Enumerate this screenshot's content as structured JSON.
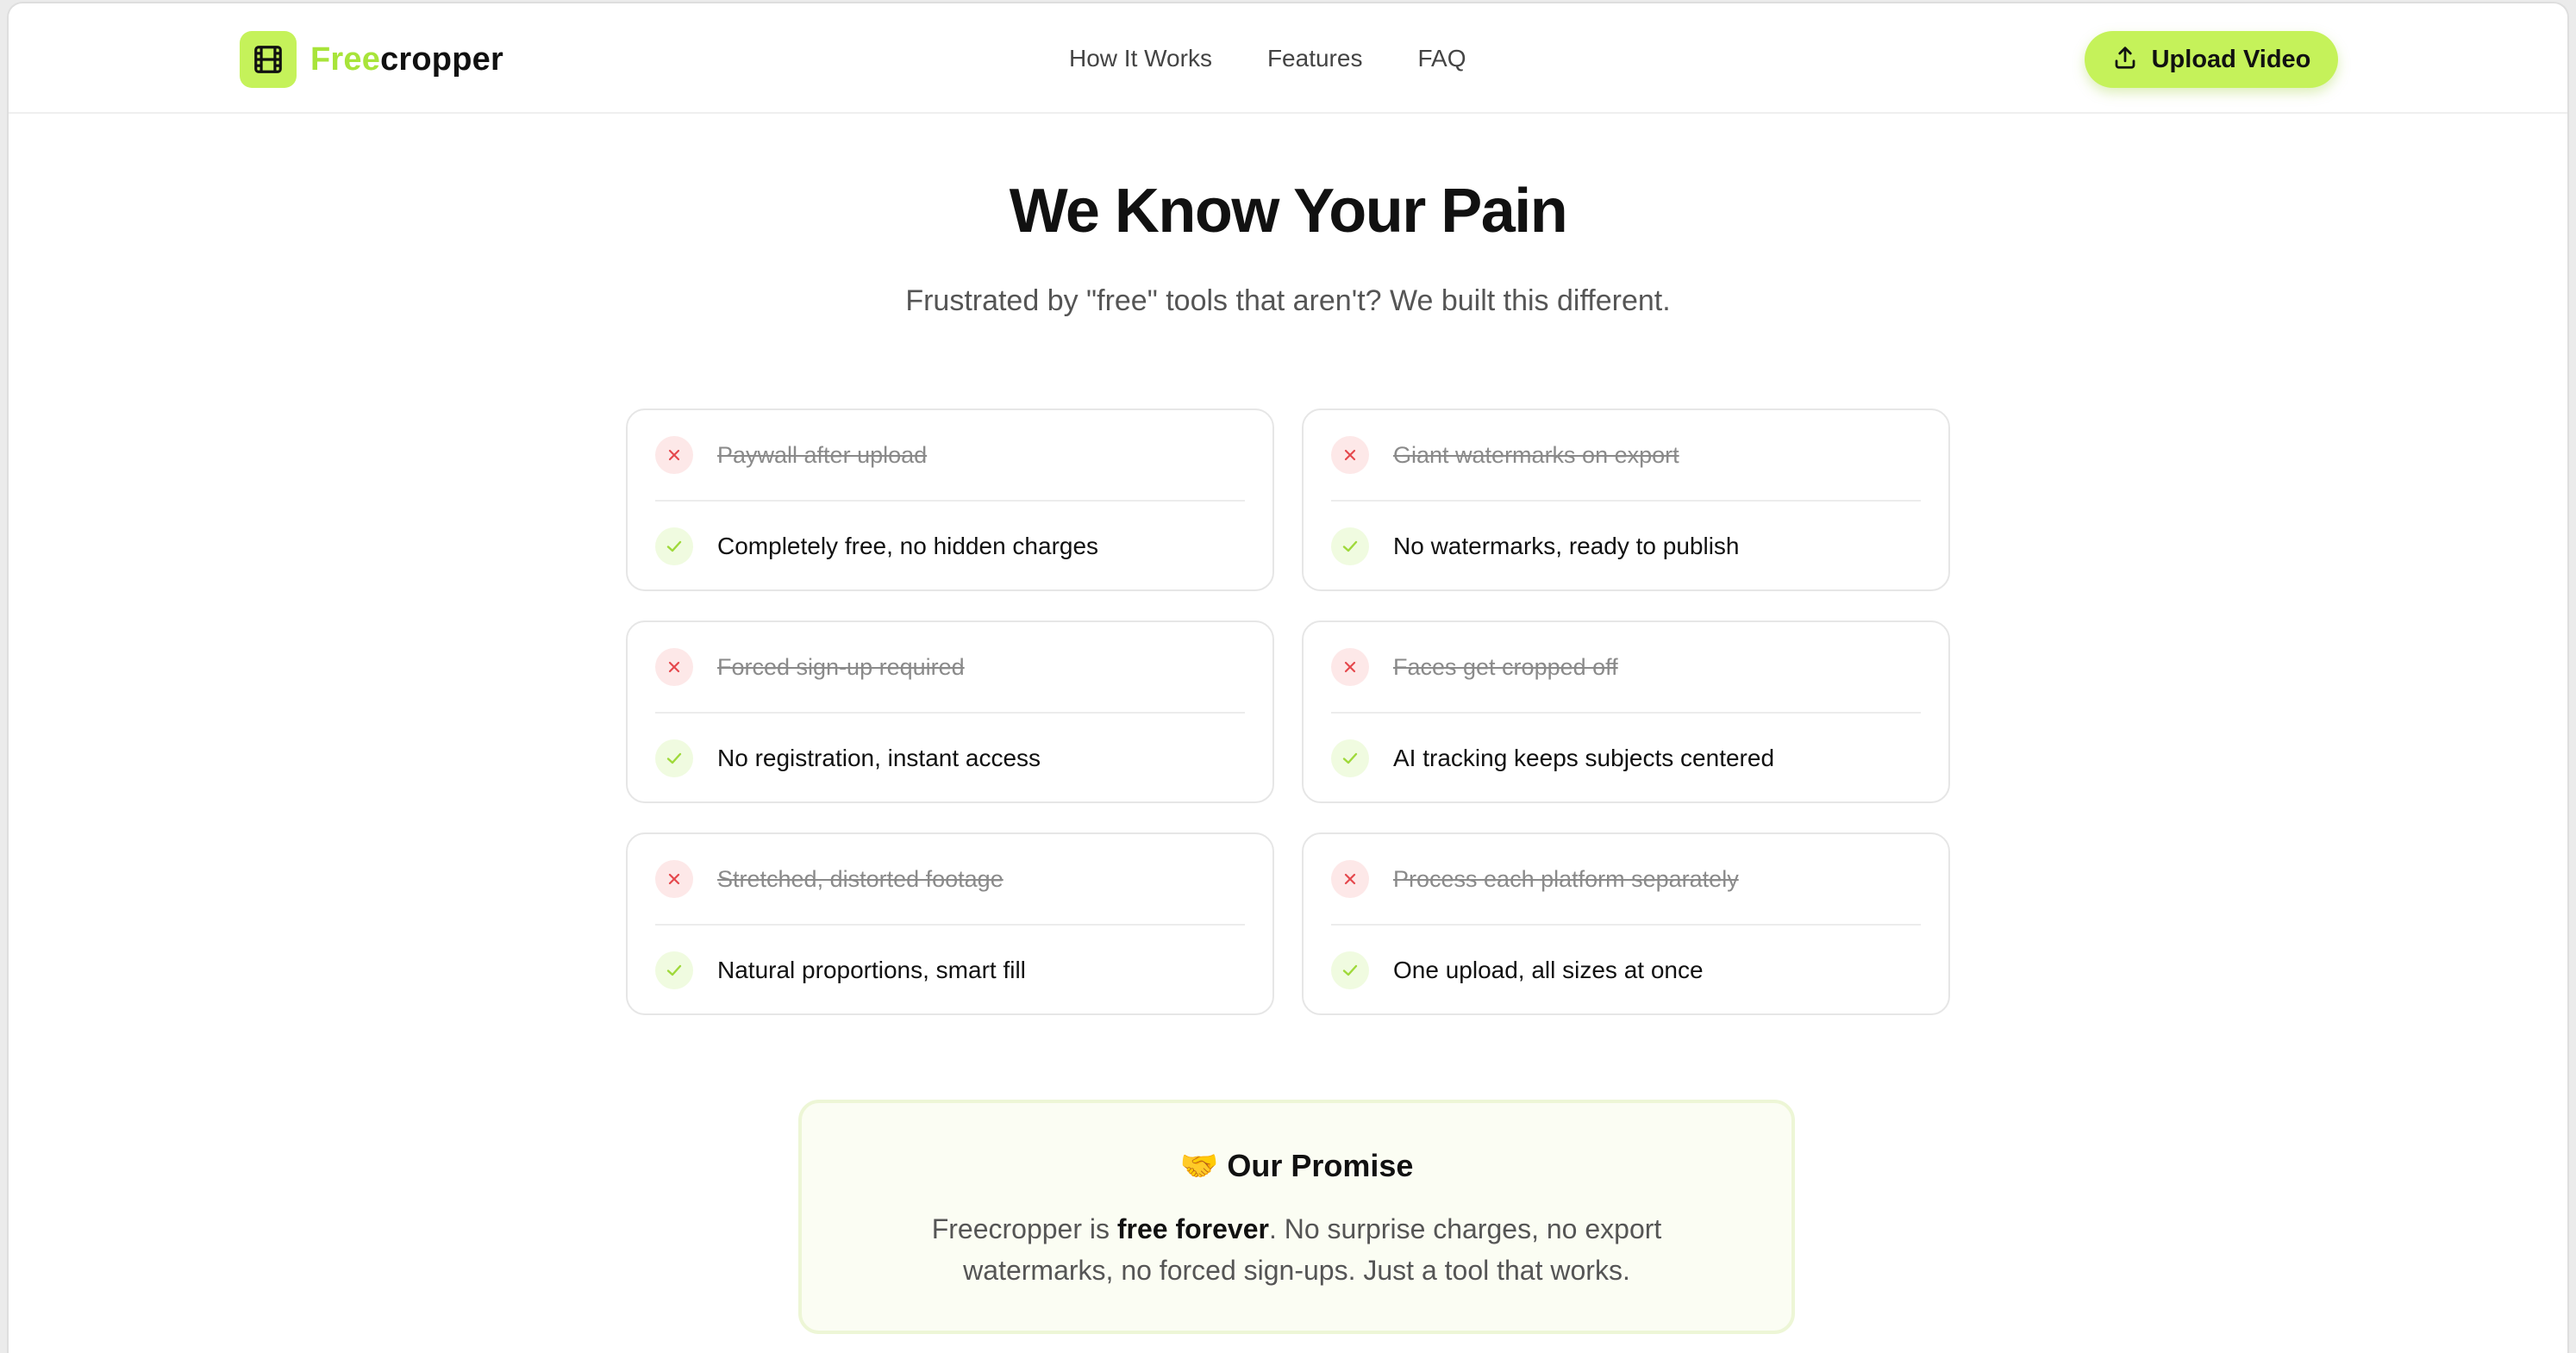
{
  "header": {
    "brand_free": "Free",
    "brand_rest": "cropper",
    "nav": [
      "How It Works",
      "Features",
      "FAQ"
    ],
    "upload_label": "Upload Video"
  },
  "hero": {
    "title": "We Know Your Pain",
    "subtitle": "Frustrated by \"free\" tools that aren't? We built this different."
  },
  "cards": [
    {
      "bad": "Paywall after upload",
      "good": "Completely free, no hidden charges"
    },
    {
      "bad": "Giant watermarks on export",
      "good": "No watermarks, ready to publish"
    },
    {
      "bad": "Forced sign-up required",
      "good": "No registration, instant access"
    },
    {
      "bad": "Faces get cropped off",
      "good": "AI tracking keeps subjects centered"
    },
    {
      "bad": "Stretched, distorted footage",
      "good": "Natural proportions, smart fill"
    },
    {
      "bad": "Process each platform separately",
      "good": "One upload, all sizes at once"
    }
  ],
  "promise": {
    "emoji": "🤝",
    "title": "Our Promise",
    "body_before": "Freecropper is ",
    "body_bold": "free forever",
    "body_after": ". No surprise charges, no export watermarks, no forced sign-ups. Just a tool that works."
  },
  "colors": {
    "accent": "#c5f25a",
    "accent_text": "#a8e43a",
    "x_icon": "#e5484d",
    "check_icon": "#9fd93a"
  },
  "icons": {
    "logo": "film-icon",
    "upload": "upload-icon",
    "bad": "x-icon",
    "good": "check-icon"
  }
}
